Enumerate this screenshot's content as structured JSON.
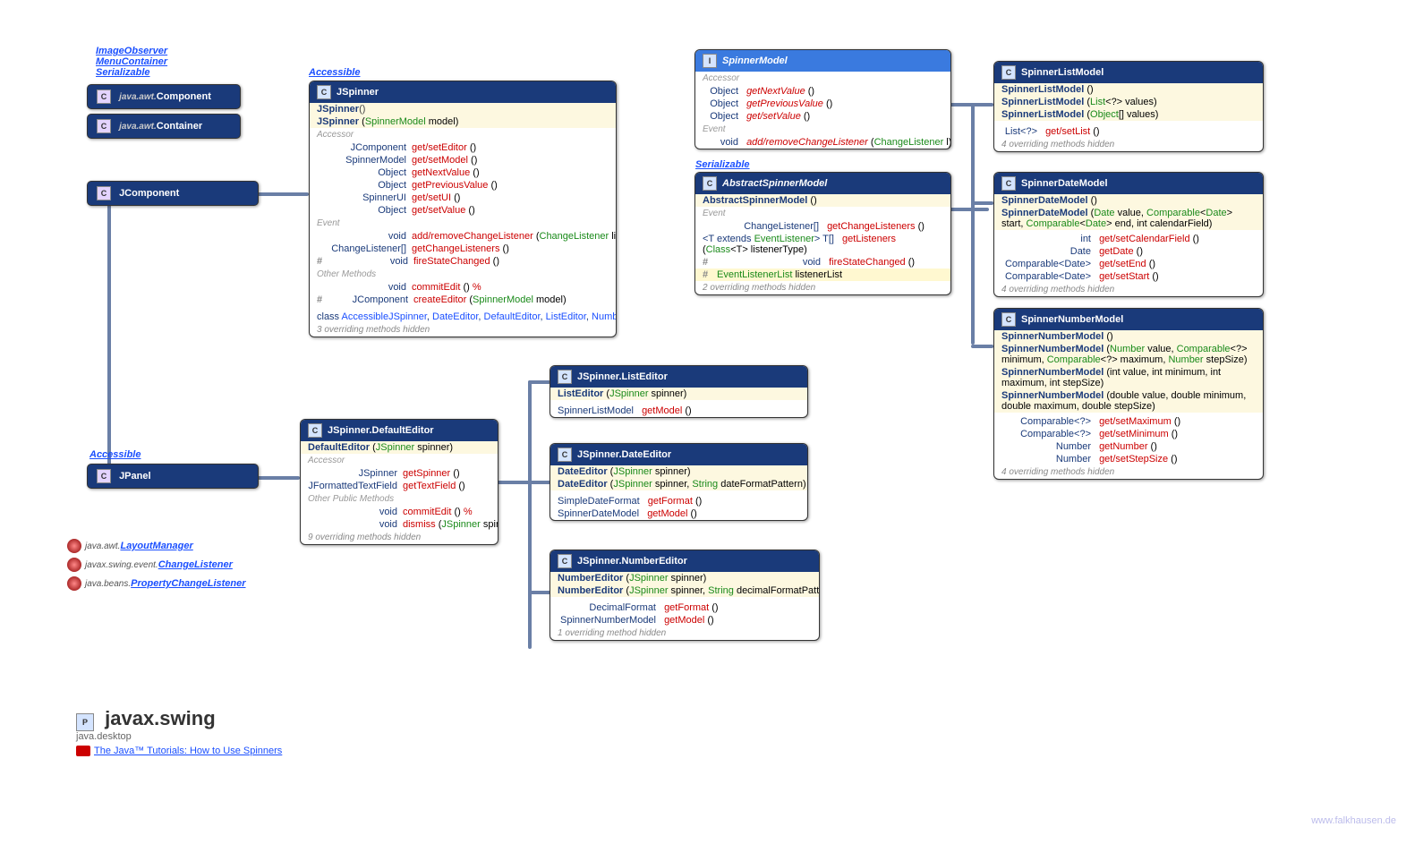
{
  "links": {
    "imageObserver": "ImageObserver",
    "menuContainer": "MenuContainer",
    "serializable": "Serializable",
    "accessible": "Accessible",
    "layoutManager": "LayoutManager",
    "layoutManagerPkg": "java.awt.",
    "changeListener": "ChangeListener",
    "changeListenerPkg": "javax.swing.event.",
    "propertyChangeListener": "PropertyChangeListener",
    "propertyChangeListenerPkg": "java.beans.",
    "tutorials": "The Java™ Tutorials: How to Use Spinners",
    "watermark": "www.falkhausen.de"
  },
  "footer": {
    "pkg": "javax.swing",
    "module": "java.desktop"
  },
  "hierarchy": {
    "component": {
      "pkg": "java.awt.",
      "name": "Component"
    },
    "container": {
      "pkg": "java.awt.",
      "name": "Container"
    },
    "jcomponent": "JComponent",
    "jpanel": "JPanel"
  },
  "jspinner": {
    "title": "JSpinner",
    "ctorSection": [
      {
        "name": "JSpinner",
        "params": "()"
      },
      {
        "name": "JSpinner",
        "params": "(SpinnerModel model)",
        "paramTypes": [
          "SpinnerModel"
        ]
      }
    ],
    "accessor": [
      {
        "ret": "JComponent",
        "name": "get/setEditor",
        "params": "()"
      },
      {
        "ret": "SpinnerModel",
        "name": "get/setModel",
        "params": "()"
      },
      {
        "ret": "Object",
        "name": "getNextValue",
        "params": "()"
      },
      {
        "ret": "Object",
        "name": "getPreviousValue",
        "params": "()"
      },
      {
        "ret": "SpinnerUI",
        "name": "get/setUI",
        "params": "()"
      },
      {
        "ret": "Object",
        "name": "get/setValue",
        "params": "()"
      }
    ],
    "event": [
      {
        "ret": "void",
        "name": "add/removeChangeListener",
        "params": "(ChangeListener listener)",
        "paramTypes": [
          "ChangeListener"
        ]
      },
      {
        "ret": "ChangeListener[]",
        "name": "getChangeListeners",
        "params": "()"
      },
      {
        "ret": "void",
        "name": "fireStateChanged",
        "prot": true,
        "params": "()"
      }
    ],
    "other": [
      {
        "ret": "void",
        "name": "commitEdit",
        "params": "() ",
        "throws": "%"
      },
      {
        "ret": "JComponent",
        "name": "createEditor",
        "prot": true,
        "params": "(SpinnerModel model)",
        "paramTypes": [
          "SpinnerModel"
        ]
      }
    ],
    "inner": "class AccessibleJSpinner, DateEditor, DefaultEditor, ListEditor, NumberEditor",
    "hidden": "3 overriding methods hidden"
  },
  "defaultEditor": {
    "title": "JSpinner.DefaultEditor",
    "ctors": [
      {
        "name": "DefaultEditor",
        "params": "(JSpinner spinner)",
        "paramTypes": [
          "JSpinner"
        ]
      }
    ],
    "accessor": [
      {
        "ret": "JSpinner",
        "name": "getSpinner",
        "params": "()"
      },
      {
        "ret": "JFormattedTextField",
        "name": "getTextField",
        "params": "()"
      }
    ],
    "other": [
      {
        "ret": "void",
        "name": "commitEdit",
        "params": "() ",
        "throws": "%"
      },
      {
        "ret": "void",
        "name": "dismiss",
        "params": "(JSpinner spinner)",
        "paramTypes": [
          "JSpinner"
        ]
      }
    ],
    "hidden": "9 overriding methods hidden"
  },
  "listEditor": {
    "title": "JSpinner.ListEditor",
    "ctors": [
      {
        "name": "ListEditor",
        "params": "(JSpinner spinner)",
        "paramTypes": [
          "JSpinner"
        ]
      }
    ],
    "methods": [
      {
        "ret": "SpinnerListModel",
        "name": "getModel",
        "params": "()"
      }
    ]
  },
  "dateEditor": {
    "title": "JSpinner.DateEditor",
    "ctors": [
      {
        "name": "DateEditor",
        "params": "(JSpinner spinner)",
        "paramTypes": [
          "JSpinner"
        ]
      },
      {
        "name": "DateEditor",
        "params": "(JSpinner spinner, String dateFormatPattern)",
        "paramTypes": [
          "JSpinner",
          "String"
        ]
      }
    ],
    "methods": [
      {
        "ret": "SimpleDateFormat",
        "name": "getFormat",
        "params": "()"
      },
      {
        "ret": "SpinnerDateModel",
        "name": "getModel",
        "params": "()"
      }
    ]
  },
  "numberEditor": {
    "title": "JSpinner.NumberEditor",
    "ctors": [
      {
        "name": "NumberEditor",
        "params": "(JSpinner spinner)",
        "paramTypes": [
          "JSpinner"
        ]
      },
      {
        "name": "NumberEditor",
        "params": "(JSpinner spinner, String decimalFormatPattern)",
        "paramTypes": [
          "JSpinner",
          "String"
        ]
      }
    ],
    "methods": [
      {
        "ret": "DecimalFormat",
        "name": "getFormat",
        "params": "()"
      },
      {
        "ret": "SpinnerNumberModel",
        "name": "getModel",
        "params": "()"
      }
    ],
    "hidden": "1 overriding method hidden"
  },
  "spinnerModel": {
    "title": "SpinnerModel",
    "accessor": [
      {
        "ret": "Object",
        "name": "getNextValue",
        "params": "()"
      },
      {
        "ret": "Object",
        "name": "getPreviousValue",
        "params": "()"
      },
      {
        "ret": "Object",
        "name": "get/setValue",
        "params": "()"
      }
    ],
    "event": [
      {
        "ret": "void",
        "name": "add/removeChangeListener",
        "params": "(ChangeListener l)",
        "paramTypes": [
          "ChangeListener"
        ]
      }
    ]
  },
  "abstractSpinnerModel": {
    "title": "AbstractSpinnerModel",
    "ctors": [
      {
        "name": "AbstractSpinnerModel",
        "params": "()"
      }
    ],
    "event": [
      {
        "ret": "ChangeListener[]",
        "name": "getChangeListeners",
        "params": "()"
      },
      {
        "ret": "<T extends EventListener> T[]",
        "name": "getListeners",
        "params": "(Class<T> listenerType)",
        "paramTypes": [
          "Class"
        ]
      },
      {
        "ret": "void",
        "name": "fireStateChanged",
        "prot": true,
        "params": "()"
      }
    ],
    "field": {
      "prot": true,
      "type": "EventListenerList",
      "name": "listenerList"
    },
    "hidden": "2 overriding methods hidden"
  },
  "spinnerListModel": {
    "title": "SpinnerListModel",
    "ctors": [
      {
        "name": "SpinnerListModel",
        "params": "()"
      },
      {
        "name": "SpinnerListModel",
        "params": "(List<?> values)",
        "paramTypes": [
          "List"
        ]
      },
      {
        "name": "SpinnerListModel",
        "params": "(Object[] values)",
        "paramTypes": [
          "Object[]"
        ]
      }
    ],
    "methods": [
      {
        "ret": "List<?>",
        "name": "get/setList",
        "params": "()"
      }
    ],
    "hidden": "4 overriding methods hidden"
  },
  "spinnerDateModel": {
    "title": "SpinnerDateModel",
    "ctors": [
      {
        "name": "SpinnerDateModel",
        "params": "()"
      },
      {
        "name": "SpinnerDateModel",
        "params": "(Date value, Comparable<Date> start, Comparable<Date> end, int calendarField)"
      }
    ],
    "methods": [
      {
        "ret": "int",
        "name": "get/setCalendarField",
        "params": "()"
      },
      {
        "ret": "Date",
        "name": "getDate",
        "params": "()"
      },
      {
        "ret": "Comparable<Date>",
        "name": "get/setEnd",
        "params": "()"
      },
      {
        "ret": "Comparable<Date>",
        "name": "get/setStart",
        "params": "()"
      }
    ],
    "hidden": "4 overriding methods hidden"
  },
  "spinnerNumberModel": {
    "title": "SpinnerNumberModel",
    "ctors": [
      {
        "name": "SpinnerNumberModel",
        "params": "()"
      },
      {
        "name": "SpinnerNumberModel",
        "params": "(Number value, Comparable<?> minimum, Comparable<?> maximum, Number stepSize)"
      },
      {
        "name": "SpinnerNumberModel",
        "params": "(int value, int minimum, int maximum, int stepSize)"
      },
      {
        "name": "SpinnerNumberModel",
        "params": "(double value, double minimum, double maximum, double stepSize)"
      }
    ],
    "methods": [
      {
        "ret": "Comparable<?>",
        "name": "get/setMaximum",
        "params": "()"
      },
      {
        "ret": "Comparable<?>",
        "name": "get/setMinimum",
        "params": "()"
      },
      {
        "ret": "Number",
        "name": "getNumber",
        "params": "()"
      },
      {
        "ret": "Number",
        "name": "get/setStepSize",
        "params": "()"
      }
    ],
    "hidden": "4 overriding methods hidden"
  }
}
